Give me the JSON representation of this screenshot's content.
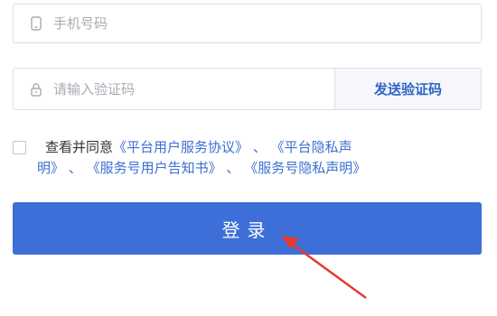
{
  "phone": {
    "placeholder": "手机号码",
    "icon": "phone-icon"
  },
  "code": {
    "placeholder": "请输入验证码",
    "icon": "lock-icon",
    "send_label": "发送验证码"
  },
  "agreement": {
    "checked": false,
    "prefix": "查看并同意",
    "links": [
      "《平台用户服务协议》",
      "《平台隐私声明》",
      "《服务号用户告知书》",
      "《服务号隐私声明》"
    ],
    "separator": "、"
  },
  "login": {
    "label": "登录"
  },
  "colors": {
    "primary": "#3e6fd8",
    "link": "#3b6fd1",
    "annotation_arrow": "#e23b2e"
  }
}
